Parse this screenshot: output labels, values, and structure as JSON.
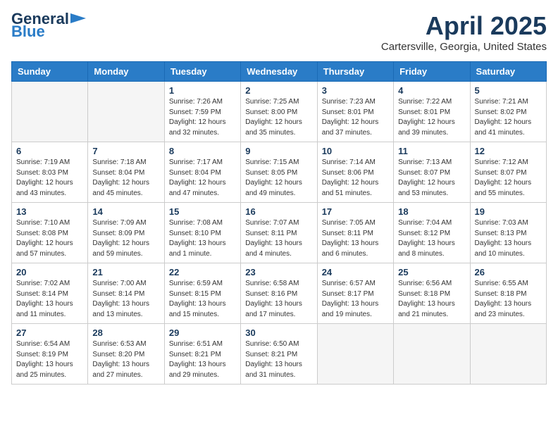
{
  "header": {
    "logo_general": "General",
    "logo_blue": "Blue",
    "title": "April 2025",
    "location": "Cartersville, Georgia, United States"
  },
  "weekdays": [
    "Sunday",
    "Monday",
    "Tuesday",
    "Wednesday",
    "Thursday",
    "Friday",
    "Saturday"
  ],
  "weeks": [
    [
      {
        "day": "",
        "info": ""
      },
      {
        "day": "",
        "info": ""
      },
      {
        "day": "1",
        "info": "Sunrise: 7:26 AM\nSunset: 7:59 PM\nDaylight: 12 hours and 32 minutes."
      },
      {
        "day": "2",
        "info": "Sunrise: 7:25 AM\nSunset: 8:00 PM\nDaylight: 12 hours and 35 minutes."
      },
      {
        "day": "3",
        "info": "Sunrise: 7:23 AM\nSunset: 8:01 PM\nDaylight: 12 hours and 37 minutes."
      },
      {
        "day": "4",
        "info": "Sunrise: 7:22 AM\nSunset: 8:01 PM\nDaylight: 12 hours and 39 minutes."
      },
      {
        "day": "5",
        "info": "Sunrise: 7:21 AM\nSunset: 8:02 PM\nDaylight: 12 hours and 41 minutes."
      }
    ],
    [
      {
        "day": "6",
        "info": "Sunrise: 7:19 AM\nSunset: 8:03 PM\nDaylight: 12 hours and 43 minutes."
      },
      {
        "day": "7",
        "info": "Sunrise: 7:18 AM\nSunset: 8:04 PM\nDaylight: 12 hours and 45 minutes."
      },
      {
        "day": "8",
        "info": "Sunrise: 7:17 AM\nSunset: 8:04 PM\nDaylight: 12 hours and 47 minutes."
      },
      {
        "day": "9",
        "info": "Sunrise: 7:15 AM\nSunset: 8:05 PM\nDaylight: 12 hours and 49 minutes."
      },
      {
        "day": "10",
        "info": "Sunrise: 7:14 AM\nSunset: 8:06 PM\nDaylight: 12 hours and 51 minutes."
      },
      {
        "day": "11",
        "info": "Sunrise: 7:13 AM\nSunset: 8:07 PM\nDaylight: 12 hours and 53 minutes."
      },
      {
        "day": "12",
        "info": "Sunrise: 7:12 AM\nSunset: 8:07 PM\nDaylight: 12 hours and 55 minutes."
      }
    ],
    [
      {
        "day": "13",
        "info": "Sunrise: 7:10 AM\nSunset: 8:08 PM\nDaylight: 12 hours and 57 minutes."
      },
      {
        "day": "14",
        "info": "Sunrise: 7:09 AM\nSunset: 8:09 PM\nDaylight: 12 hours and 59 minutes."
      },
      {
        "day": "15",
        "info": "Sunrise: 7:08 AM\nSunset: 8:10 PM\nDaylight: 13 hours and 1 minute."
      },
      {
        "day": "16",
        "info": "Sunrise: 7:07 AM\nSunset: 8:11 PM\nDaylight: 13 hours and 4 minutes."
      },
      {
        "day": "17",
        "info": "Sunrise: 7:05 AM\nSunset: 8:11 PM\nDaylight: 13 hours and 6 minutes."
      },
      {
        "day": "18",
        "info": "Sunrise: 7:04 AM\nSunset: 8:12 PM\nDaylight: 13 hours and 8 minutes."
      },
      {
        "day": "19",
        "info": "Sunrise: 7:03 AM\nSunset: 8:13 PM\nDaylight: 13 hours and 10 minutes."
      }
    ],
    [
      {
        "day": "20",
        "info": "Sunrise: 7:02 AM\nSunset: 8:14 PM\nDaylight: 13 hours and 11 minutes."
      },
      {
        "day": "21",
        "info": "Sunrise: 7:00 AM\nSunset: 8:14 PM\nDaylight: 13 hours and 13 minutes."
      },
      {
        "day": "22",
        "info": "Sunrise: 6:59 AM\nSunset: 8:15 PM\nDaylight: 13 hours and 15 minutes."
      },
      {
        "day": "23",
        "info": "Sunrise: 6:58 AM\nSunset: 8:16 PM\nDaylight: 13 hours and 17 minutes."
      },
      {
        "day": "24",
        "info": "Sunrise: 6:57 AM\nSunset: 8:17 PM\nDaylight: 13 hours and 19 minutes."
      },
      {
        "day": "25",
        "info": "Sunrise: 6:56 AM\nSunset: 8:18 PM\nDaylight: 13 hours and 21 minutes."
      },
      {
        "day": "26",
        "info": "Sunrise: 6:55 AM\nSunset: 8:18 PM\nDaylight: 13 hours and 23 minutes."
      }
    ],
    [
      {
        "day": "27",
        "info": "Sunrise: 6:54 AM\nSunset: 8:19 PM\nDaylight: 13 hours and 25 minutes."
      },
      {
        "day": "28",
        "info": "Sunrise: 6:53 AM\nSunset: 8:20 PM\nDaylight: 13 hours and 27 minutes."
      },
      {
        "day": "29",
        "info": "Sunrise: 6:51 AM\nSunset: 8:21 PM\nDaylight: 13 hours and 29 minutes."
      },
      {
        "day": "30",
        "info": "Sunrise: 6:50 AM\nSunset: 8:21 PM\nDaylight: 13 hours and 31 minutes."
      },
      {
        "day": "",
        "info": ""
      },
      {
        "day": "",
        "info": ""
      },
      {
        "day": "",
        "info": ""
      }
    ]
  ]
}
